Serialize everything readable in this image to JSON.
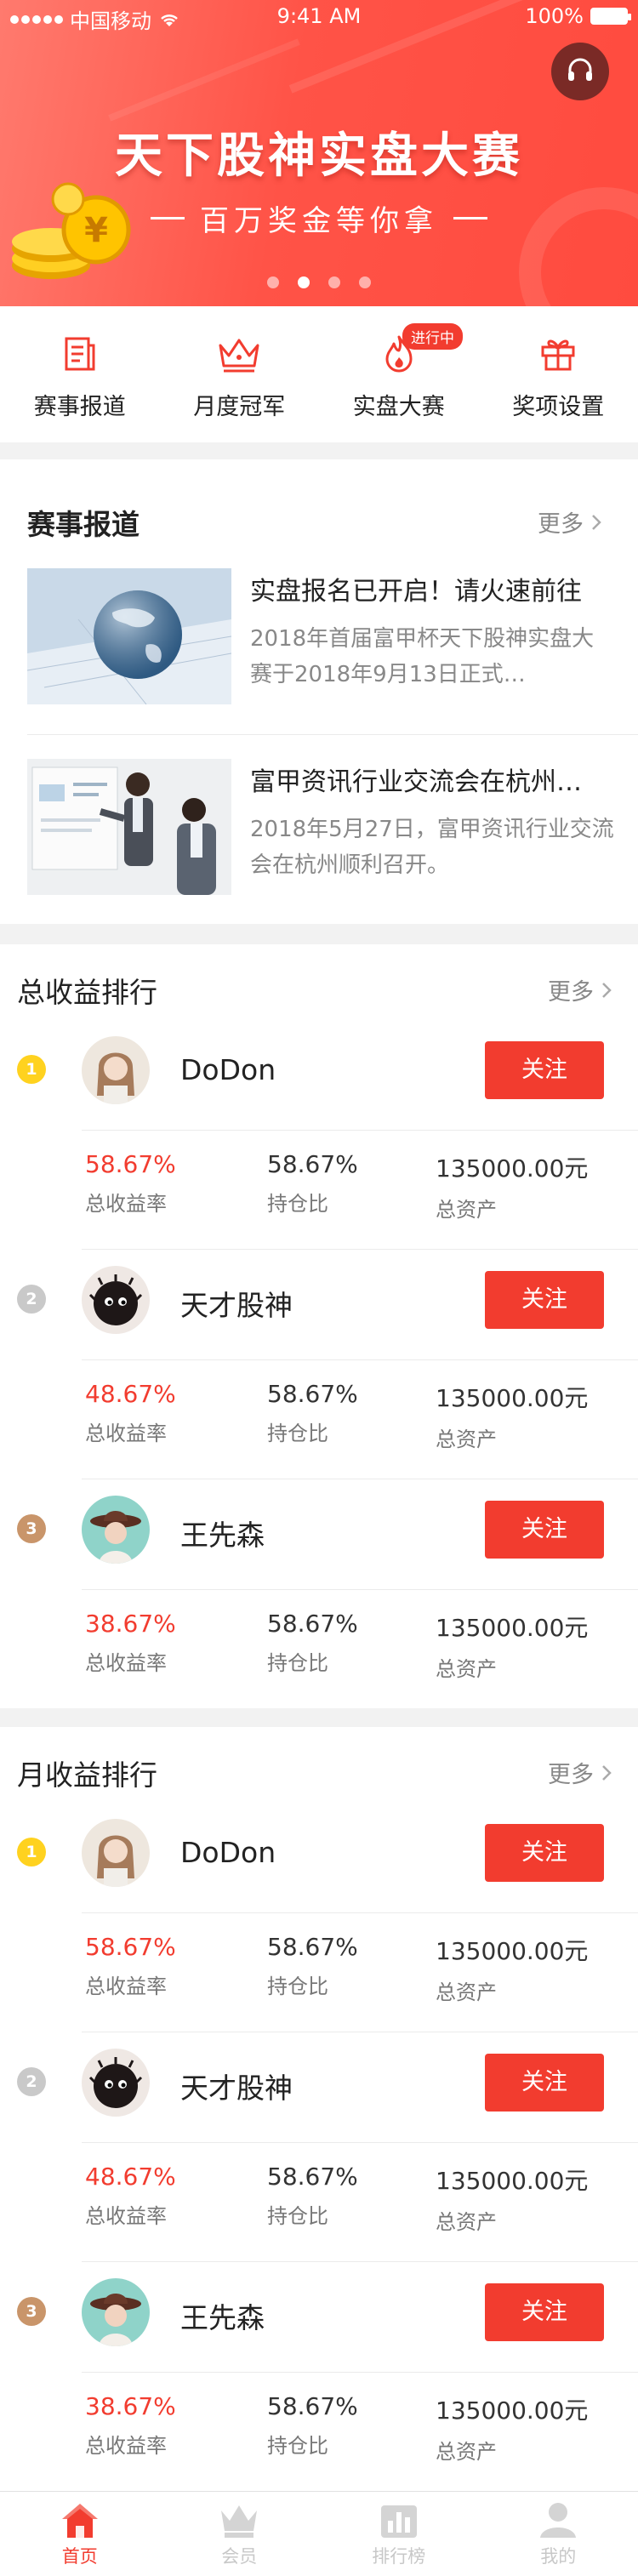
{
  "status": {
    "carrier": "中国移动",
    "time": "9:41 AM",
    "battery": "100%"
  },
  "banner": {
    "title": "天下股神实盘大赛",
    "subtitle": "百万奖金等你拿",
    "slides": 4,
    "active_slide": 2
  },
  "quicknav": [
    {
      "label": "赛事报道",
      "icon": "newspaper-icon"
    },
    {
      "label": "月度冠军",
      "icon": "crown-icon"
    },
    {
      "label": "实盘大赛",
      "icon": "flame-icon",
      "badge": "进行中"
    },
    {
      "label": "奖项设置",
      "icon": "gift-icon"
    }
  ],
  "news": {
    "title": "赛事报道",
    "more": "更多",
    "items": [
      {
        "title": "实盘报名已开启！请火速前往",
        "desc": "2018年首届富甲杯天下股神实盘大赛于2018年9月13日正式…"
      },
      {
        "title": "富甲资讯行业交流会在杭州…",
        "desc": "2018年5月27日，富甲资讯行业交流会在杭州顺利召开。"
      }
    ]
  },
  "total_rank": {
    "title": "总收益排行",
    "more": "更多",
    "rows": [
      {
        "rank": "1",
        "name": "DoDon",
        "follow": "关注",
        "yield": "58.67%",
        "yield_label": "总收益率",
        "position": "58.67%",
        "position_label": "持仓比",
        "assets": "135000.00元",
        "assets_label": "总资产"
      },
      {
        "rank": "2",
        "name": "天才股神",
        "follow": "关注",
        "yield": "48.67%",
        "yield_label": "总收益率",
        "position": "58.67%",
        "position_label": "持仓比",
        "assets": "135000.00元",
        "assets_label": "总资产"
      },
      {
        "rank": "3",
        "name": "王先森",
        "follow": "关注",
        "yield": "38.67%",
        "yield_label": "总收益率",
        "position": "58.67%",
        "position_label": "持仓比",
        "assets": "135000.00元",
        "assets_label": "总资产"
      }
    ]
  },
  "month_rank": {
    "title": "月收益排行",
    "more": "更多",
    "rows": [
      {
        "rank": "1",
        "name": "DoDon",
        "follow": "关注",
        "yield": "58.67%",
        "yield_label": "总收益率",
        "position": "58.67%",
        "position_label": "持仓比",
        "assets": "135000.00元",
        "assets_label": "总资产"
      },
      {
        "rank": "2",
        "name": "天才股神",
        "follow": "关注",
        "yield": "48.67%",
        "yield_label": "总收益率",
        "position": "58.67%",
        "position_label": "持仓比",
        "assets": "135000.00元",
        "assets_label": "总资产"
      },
      {
        "rank": "3",
        "name": "王先森",
        "follow": "关注",
        "yield": "38.67%",
        "yield_label": "总收益率",
        "position": "58.67%",
        "position_label": "持仓比",
        "assets": "135000.00元",
        "assets_label": "总资产"
      }
    ]
  },
  "tabbar": [
    {
      "label": "首页",
      "icon": "home-icon",
      "active": true
    },
    {
      "label": "会员",
      "icon": "crown-icon",
      "active": false
    },
    {
      "label": "排行榜",
      "icon": "ranking-icon",
      "active": false
    },
    {
      "label": "我的",
      "icon": "user-icon",
      "active": false
    }
  ],
  "colors": {
    "accent": "#f23c2f",
    "gold": "#ffd21f",
    "silver": "#c9c9c9",
    "bronze": "#c9956a"
  }
}
